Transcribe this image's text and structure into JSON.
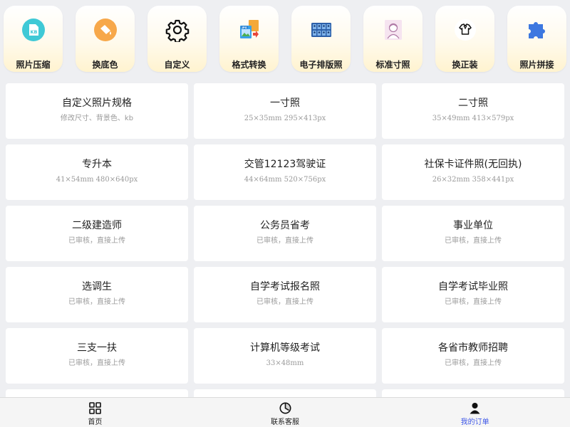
{
  "tools": [
    {
      "label": "照片压缩",
      "icon": "compress-photo-icon",
      "badge": "KB"
    },
    {
      "label": "换底色",
      "icon": "paint-bucket-icon"
    },
    {
      "label": "自定义",
      "icon": "gear-icon"
    },
    {
      "label": "格式转换",
      "icon": "format-convert-icon",
      "badge": "JPG"
    },
    {
      "label": "电子排版照",
      "icon": "photo-layout-icon"
    },
    {
      "label": "标准寸照",
      "icon": "portrait-icon"
    },
    {
      "label": "换正装",
      "icon": "shirt-icon"
    },
    {
      "label": "照片拼接",
      "icon": "puzzle-icon"
    }
  ],
  "cards": [
    {
      "title": "自定义照片规格",
      "subtitle": "修改尺寸、背景色、kb"
    },
    {
      "title": "一寸照",
      "subtitle": "25×35mm 295×413px"
    },
    {
      "title": "二寸照",
      "subtitle": "35×49mm 413×579px"
    },
    {
      "title": "专升本",
      "subtitle": "41×54mm 480×640px"
    },
    {
      "title": "交管12123驾驶证",
      "subtitle": "44×64mm 520×756px"
    },
    {
      "title": "社保卡证件照(无回执)",
      "subtitle": "26×32mm 358×441px"
    },
    {
      "title": "二级建造师",
      "subtitle": "已审核，直接上传"
    },
    {
      "title": "公务员省考",
      "subtitle": "已审核，直接上传"
    },
    {
      "title": "事业单位",
      "subtitle": "已审核，直接上传"
    },
    {
      "title": "选调生",
      "subtitle": "已审核，直接上传"
    },
    {
      "title": "自学考试报名照",
      "subtitle": "已审核，直接上传"
    },
    {
      "title": "自学考试毕业照",
      "subtitle": "已审核，直接上传"
    },
    {
      "title": "三支一扶",
      "subtitle": "已审核，直接上传"
    },
    {
      "title": "计算机等级考试",
      "subtitle": "33×48mm"
    },
    {
      "title": "各省市教师招聘",
      "subtitle": "已审核，直接上传"
    },
    {
      "title": "",
      "subtitle": ""
    },
    {
      "title": "",
      "subtitle": ""
    },
    {
      "title": "",
      "subtitle": ""
    }
  ],
  "nav": [
    {
      "label": "首页",
      "icon": "home-grid-icon"
    },
    {
      "label": "联系客服",
      "icon": "customer-service-icon"
    },
    {
      "label": "我的订单",
      "icon": "user-icon",
      "active": true
    }
  ],
  "colors": {
    "accent": "#3f58e8",
    "tile_bg_bottom": "#fff3cf",
    "page_bg": "#eeeff2",
    "icon_teal": "#3fc9d6",
    "icon_orange": "#f7a84a",
    "icon_blue": "#3d78e0"
  }
}
